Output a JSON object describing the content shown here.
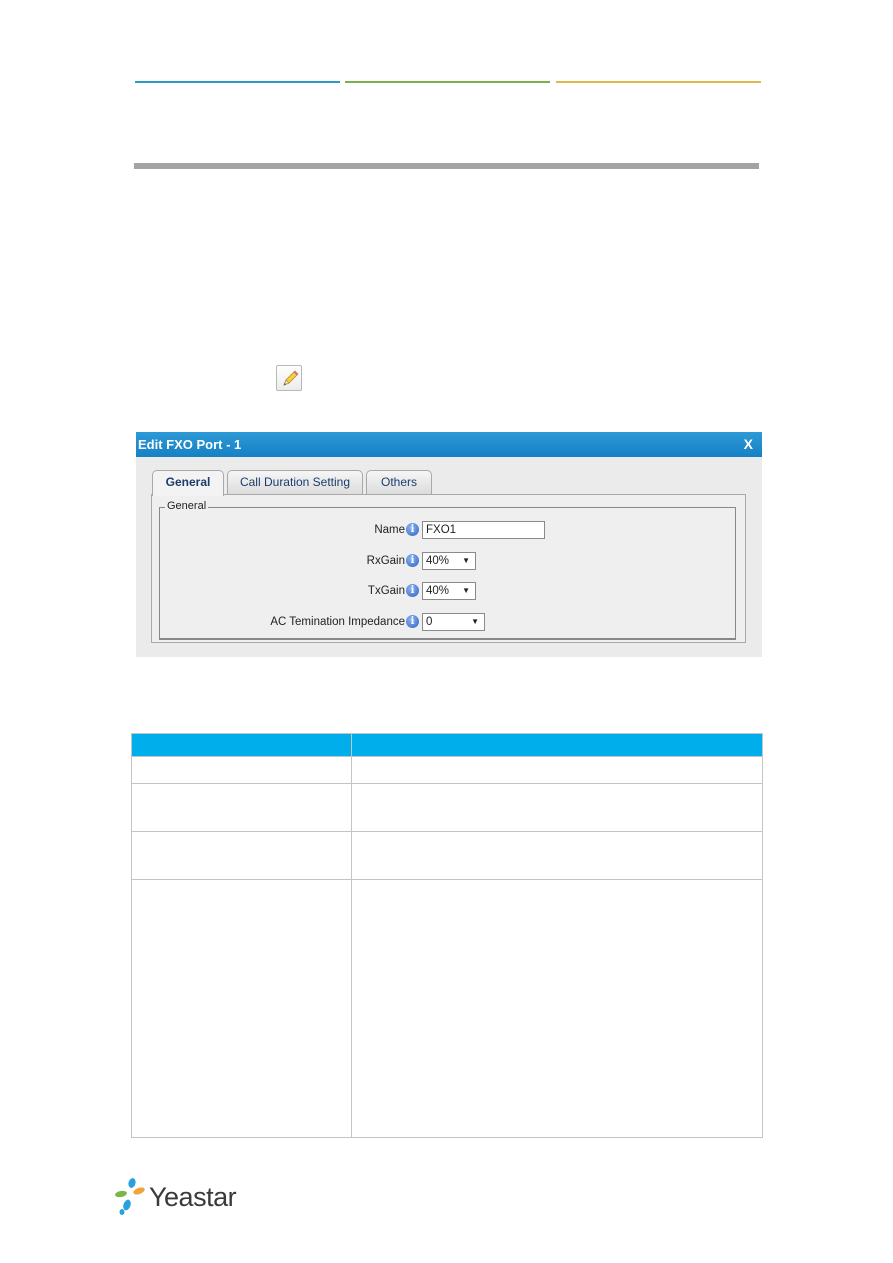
{
  "header": {
    "line_colors": [
      "#2b9bc6",
      "#7bb04a",
      "#e3b84a"
    ],
    "section_bar_color": "#a3a3a3"
  },
  "edit_button": {
    "icon": "pencil-icon"
  },
  "dialog": {
    "title": "Edit FXO Port - 1",
    "close_label": "X",
    "title_bar_color": "#1e8ccd",
    "tabs": [
      {
        "label": "General",
        "active": true
      },
      {
        "label": "Call Duration Setting",
        "active": false
      },
      {
        "label": "Others",
        "active": false
      }
    ],
    "fieldset_legend": "General",
    "fields": [
      {
        "label": "Name",
        "type": "input",
        "value": "FXO1"
      },
      {
        "label": "RxGain",
        "type": "select",
        "value": "40%"
      },
      {
        "label": "TxGain",
        "type": "select",
        "value": "40%"
      },
      {
        "label": "AC Temination Impedance",
        "type": "select",
        "value": "0"
      }
    ],
    "colon": ":",
    "info_glyph": "i",
    "arrow_glyph": "▼"
  },
  "table": {
    "header_color": "#00aeeb",
    "headers": [
      "",
      ""
    ],
    "rows": [
      [
        "",
        ""
      ],
      [
        "",
        ""
      ],
      [
        "",
        ""
      ],
      [
        "",
        ""
      ]
    ]
  },
  "footer": {
    "logo_text": "Yeastar"
  }
}
